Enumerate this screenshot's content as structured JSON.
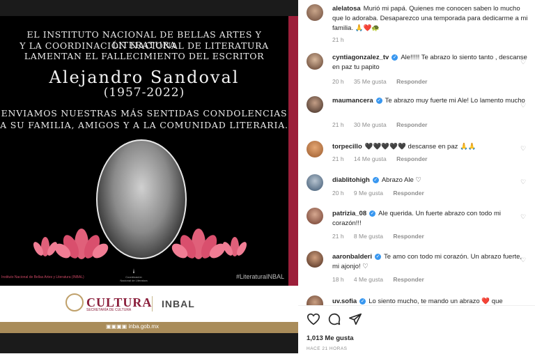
{
  "post": {
    "header_lines": [
      "El Instituto Nacional de Bellas Artes y Literatura",
      "y la Coordinación Nacional de Literatura",
      "lamentan el fallecimiento del escritor"
    ],
    "name": "Alejandro Sandoval",
    "years": "(1957-2022)",
    "condolence_lines": [
      "Enviamos nuestras más sentidas condolencias",
      "a su familia, amigos y a la comunidad literaria."
    ],
    "caption_left": "Instituto Nacional de Bellas Artes y Literatura (INBAL)",
    "caption_right": "#LiteraturaINBAL",
    "coord_logo_text": "Coordinación Nacional de Literatura",
    "cultura": "CULTURA",
    "cultura_sub": "SECRETARÍA DE CULTURA",
    "inbal": "INBAL",
    "social": "inba.gob.mx",
    "colors": {
      "accent_red": "#9c1f3a",
      "gold": "#a98c5a",
      "lotus": "#e0607a"
    }
  },
  "comments": [
    {
      "user": "alelatosa",
      "verified": false,
      "text": "Murió mi papá. Quienes me conocen saben lo mucho que lo adoraba. Desaparezco una temporada para dedicarme a mi familia. 🙏❤️🐢",
      "time": "21 h",
      "likes": "",
      "reply": ""
    },
    {
      "user": "cyntiagonzalez_tv",
      "verified": true,
      "text": "Ale!!!!! Te abrazo lo siento tanto , descanse en paz tu papito",
      "time": "20 h",
      "likes": "35 Me gusta",
      "reply": "Responder"
    },
    {
      "user": "maumancera",
      "verified": true,
      "text": "Te abrazo muy fuerte mi Ale! Lo lamento mucho",
      "time": "21 h",
      "likes": "30 Me gusta",
      "reply": "Responder"
    },
    {
      "user": "torpecillo",
      "verified": false,
      "text": "🖤🖤🖤🖤🖤 descanse en paz 🙏🙏",
      "time": "21 h",
      "likes": "14 Me gusta",
      "reply": "Responder"
    },
    {
      "user": "diablitohigh",
      "verified": true,
      "text": "Abrazo Ale ♡",
      "time": "20 h",
      "likes": "9 Me gusta",
      "reply": "Responder"
    },
    {
      "user": "patrizia_08",
      "verified": true,
      "text": "Ale querida. Un fuerte abrazo con todo mi corazón!!!",
      "time": "21 h",
      "likes": "8 Me gusta",
      "reply": "Responder"
    },
    {
      "user": "aaronbalderi",
      "verified": true,
      "text": "Te amo con todo mi corazón. Un abrazo fuerte, mi ajonjo! ♡",
      "time": "18 h",
      "likes": "4 Me gusta",
      "reply": "Responder"
    },
    {
      "user": "uv.sofia",
      "verified": true,
      "text": "Lo siento mucho, te mando un abrazo ❤️ que",
      "time": "",
      "likes": "",
      "reply": ""
    }
  ],
  "actions": {
    "likes": "1,013 Me gusta",
    "time_ago": "HACE 21 HORAS"
  }
}
